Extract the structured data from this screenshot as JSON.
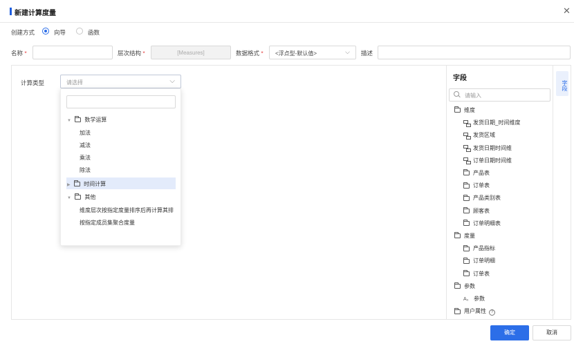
{
  "dialog": {
    "title": "新建计算度量"
  },
  "create_mode": {
    "label": "创建方式",
    "options": [
      "向导",
      "函数"
    ],
    "selected": "向导"
  },
  "form": {
    "name_label": "名称",
    "hierarchy_label": "层次结构",
    "hierarchy_value": "[Measures]",
    "format_label": "数据格式",
    "format_value": "<浮点型-默认值>",
    "desc_label": "描述",
    "required_mark": "*"
  },
  "calc_type": {
    "label": "计算类型",
    "placeholder": "请选择",
    "tree": [
      {
        "label": "数学运算",
        "expanded": true,
        "children": [
          "加法",
          "减法",
          "乘法",
          "除法"
        ]
      },
      {
        "label": "时间计算",
        "expanded": false,
        "highlighted": true,
        "children": []
      },
      {
        "label": "其他",
        "expanded": true,
        "children": [
          "维度层次按指定度量排序后再计算其排",
          "按指定成员集聚合度量"
        ]
      }
    ]
  },
  "fields": {
    "title": "字段",
    "search_placeholder": "请输入",
    "side_tab": "字段",
    "groups": [
      {
        "label": "维度",
        "items": [
          {
            "label": "发货日期_时间维度",
            "icon": "hierarchy-icon"
          },
          {
            "label": "发货区域",
            "icon": "hierarchy-icon"
          },
          {
            "label": "发货日期时间维",
            "icon": "hierarchy-icon"
          },
          {
            "label": "订单日期时间维",
            "icon": "hierarchy-icon"
          },
          {
            "label": "产品表",
            "icon": "folder-icon"
          },
          {
            "label": "订单表",
            "icon": "folder-icon"
          },
          {
            "label": "产品类别表",
            "icon": "folder-icon"
          },
          {
            "label": "顾客表",
            "icon": "folder-icon"
          },
          {
            "label": "订单明细表",
            "icon": "folder-icon"
          }
        ]
      },
      {
        "label": "度量",
        "items": [
          {
            "label": "产品指标",
            "icon": "folder-icon"
          },
          {
            "label": "订单明细",
            "icon": "folder-icon"
          },
          {
            "label": "订单表",
            "icon": "folder-icon"
          }
        ]
      },
      {
        "label": "参数",
        "items": [
          {
            "label": "参数",
            "icon": "param-icon"
          }
        ]
      },
      {
        "label": "用户属性",
        "items": []
      }
    ],
    "param_icon_text": "A₀"
  },
  "footer": {
    "ok_label": "确定",
    "cancel_label": "取消"
  },
  "colors": {
    "accent": "#2c6ee8",
    "required": "#e54545",
    "highlight": "#e3ebfb"
  }
}
